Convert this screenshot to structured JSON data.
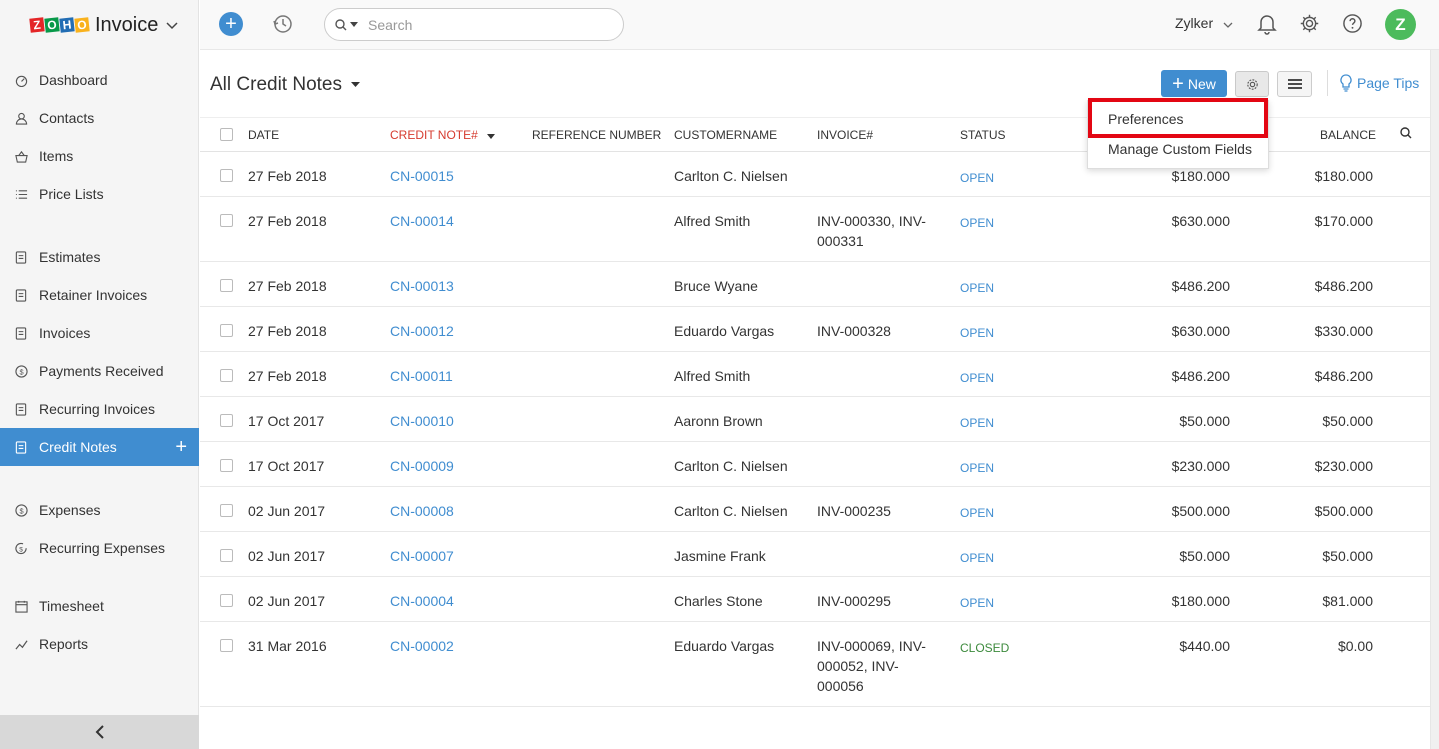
{
  "brand": {
    "app_name": "Invoice",
    "logo_letters": [
      "Z",
      "O",
      "H",
      "O"
    ]
  },
  "sidebar": {
    "items": [
      {
        "label": "Dashboard",
        "icon": "dashboard-icon",
        "active": false
      },
      {
        "label": "Contacts",
        "icon": "user-icon",
        "active": false
      },
      {
        "label": "Items",
        "icon": "basket-icon",
        "active": false
      },
      {
        "label": "Price Lists",
        "icon": "list-icon",
        "active": false
      },
      {
        "label": "Estimates",
        "icon": "estimate-icon",
        "active": false
      },
      {
        "label": "Retainer Invoices",
        "icon": "retainer-icon",
        "active": false
      },
      {
        "label": "Invoices",
        "icon": "invoice-icon",
        "active": false
      },
      {
        "label": "Payments Received",
        "icon": "payment-icon",
        "active": false
      },
      {
        "label": "Recurring Invoices",
        "icon": "recurring-invoice-icon",
        "active": false
      },
      {
        "label": "Credit Notes",
        "icon": "credit-note-icon",
        "active": true
      },
      {
        "label": "Expenses",
        "icon": "expense-icon",
        "active": false
      },
      {
        "label": "Recurring Expenses",
        "icon": "recurring-expense-icon",
        "active": false
      },
      {
        "label": "Timesheet",
        "icon": "calendar-icon",
        "active": false
      },
      {
        "label": "Reports",
        "icon": "chart-icon",
        "active": false
      }
    ],
    "active_plus": "+",
    "collapse_glyph": "‹"
  },
  "topbar": {
    "search_placeholder": "Search",
    "org_name": "Zylker",
    "avatar_letter": "Z"
  },
  "page": {
    "title": "All Credit Notes",
    "new_button": "New",
    "page_tips": "Page Tips"
  },
  "dropdown": {
    "items": [
      "Preferences",
      "Manage Custom Fields"
    ]
  },
  "table": {
    "headers": {
      "date": "DATE",
      "credit_note": "CREDIT NOTE#",
      "reference": "REFERENCE NUMBER",
      "customer": "CUSTOMERNAME",
      "invoice": "INVOICE#",
      "status": "STATUS",
      "balance": "BALANCE"
    },
    "rows": [
      {
        "date": "27 Feb 2018",
        "cn": "CN-00015",
        "customer": "Carlton C. Nielsen",
        "invoice": "",
        "status": "OPEN",
        "amount": "$180.000",
        "balance": "$180.000"
      },
      {
        "date": "27 Feb 2018",
        "cn": "CN-00014",
        "customer": "Alfred Smith",
        "invoice": "INV-000330, INV-000331",
        "status": "OPEN",
        "amount": "$630.000",
        "balance": "$170.000"
      },
      {
        "date": "27 Feb 2018",
        "cn": "CN-00013",
        "customer": "Bruce Wyane",
        "invoice": "",
        "status": "OPEN",
        "amount": "$486.200",
        "balance": "$486.200"
      },
      {
        "date": "27 Feb 2018",
        "cn": "CN-00012",
        "customer": "Eduardo Vargas",
        "invoice": "INV-000328",
        "status": "OPEN",
        "amount": "$630.000",
        "balance": "$330.000"
      },
      {
        "date": "27 Feb 2018",
        "cn": "CN-00011",
        "customer": "Alfred Smith",
        "invoice": "",
        "status": "OPEN",
        "amount": "$486.200",
        "balance": "$486.200"
      },
      {
        "date": "17 Oct 2017",
        "cn": "CN-00010",
        "customer": "Aaronn Brown",
        "invoice": "",
        "status": "OPEN",
        "amount": "$50.000",
        "balance": "$50.000"
      },
      {
        "date": "17 Oct 2017",
        "cn": "CN-00009",
        "customer": "Carlton C. Nielsen",
        "invoice": "",
        "status": "OPEN",
        "amount": "$230.000",
        "balance": "$230.000"
      },
      {
        "date": "02 Jun 2017",
        "cn": "CN-00008",
        "customer": "Carlton C. Nielsen",
        "invoice": "INV-000235",
        "status": "OPEN",
        "amount": "$500.000",
        "balance": "$500.000"
      },
      {
        "date": "02 Jun 2017",
        "cn": "CN-00007",
        "customer": "Jasmine Frank",
        "invoice": "",
        "status": "OPEN",
        "amount": "$50.000",
        "balance": "$50.000"
      },
      {
        "date": "02 Jun 2017",
        "cn": "CN-00004",
        "customer": "Charles Stone",
        "invoice": "INV-000295",
        "status": "OPEN",
        "amount": "$180.000",
        "balance": "$81.000"
      },
      {
        "date": "31 Mar 2016",
        "cn": "CN-00002",
        "customer": "Eduardo Vargas",
        "invoice": "INV-000069, INV-000052, INV-000056",
        "status": "CLOSED",
        "amount": "$440.00",
        "balance": "$0.00"
      }
    ]
  },
  "colors": {
    "accent": "#408dd0",
    "highlight": "#e30613",
    "closed": "#3c8a3c"
  }
}
